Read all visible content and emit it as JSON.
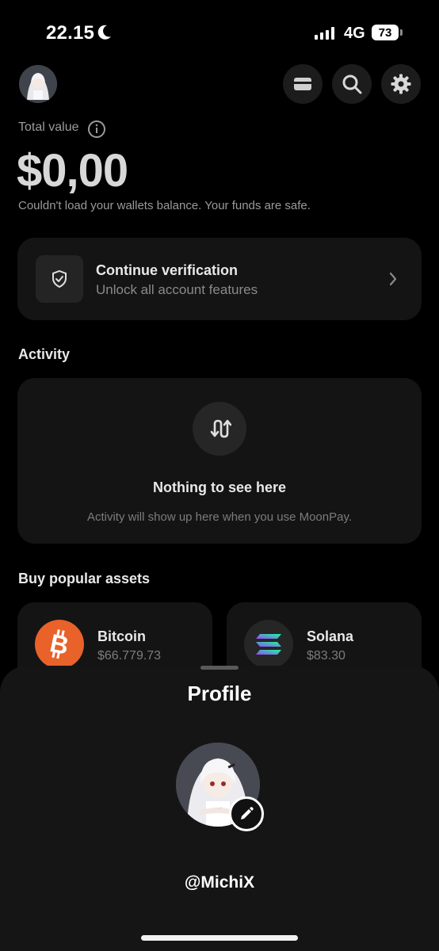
{
  "status_bar": {
    "time": "22.15",
    "network": "4G",
    "battery": "73"
  },
  "header": {
    "icons": [
      "avatar",
      "card-icon",
      "search-icon",
      "gear-icon"
    ]
  },
  "wallet": {
    "total_label": "Total value",
    "balance": "$0,00",
    "note": "Couldn't load your wallets balance. Your funds are safe."
  },
  "verification": {
    "title": "Continue verification",
    "subtitle": "Unlock all account features"
  },
  "activity": {
    "section_title": "Activity",
    "empty_title": "Nothing to see here",
    "empty_subtitle": "Activity will show up here when you use MoonPay."
  },
  "assets": {
    "section_title": "Buy popular assets",
    "items": [
      {
        "name": "Bitcoin",
        "price": "$66.779.73",
        "color": "#e8622a"
      },
      {
        "name": "Solana",
        "price": "$83.30",
        "color": "#262626"
      }
    ]
  },
  "profile_sheet": {
    "title": "Profile",
    "handle": "@MichiX"
  }
}
